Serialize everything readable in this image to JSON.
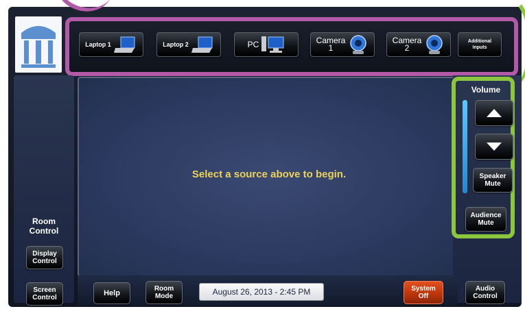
{
  "sources": [
    {
      "label": "Laptop 1",
      "icon": "laptop-icon"
    },
    {
      "label": "Laptop 2",
      "icon": "laptop-icon"
    },
    {
      "label": "PC",
      "icon": "desktop-computer-icon"
    },
    {
      "label": "Camera\n1",
      "icon": "camera-icon"
    },
    {
      "label": "Camera\n2",
      "icon": "camera-icon"
    },
    {
      "label": "Additional\nInputs",
      "icon": ""
    }
  ],
  "main": {
    "prompt": "Select a source above to begin."
  },
  "volume": {
    "title": "Volume",
    "speaker_mute": "Speaker\nMute",
    "audience_mute": "Audience\nMute"
  },
  "room_control": {
    "title": "Room\nControl",
    "display_control": "Display\nControl",
    "screen_control": "Screen\nControl"
  },
  "bottom": {
    "help": "Help",
    "room_mode": "Room\nMode",
    "datetime": "August 26, 2013  -  2:45 PM",
    "system_off": "System\nOff",
    "audio_control": "Audio\nControl"
  },
  "colors": {
    "source_bar_highlight": "#b25aa7",
    "volume_highlight": "#8cc63f",
    "prompt_text": "#ecd25b",
    "system_off": "#d2441a"
  }
}
